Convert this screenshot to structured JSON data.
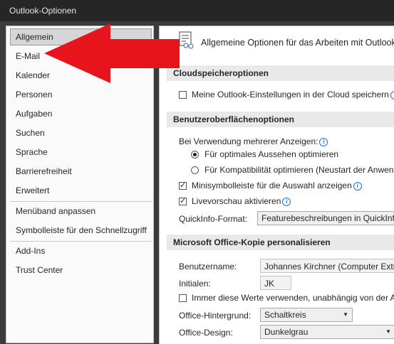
{
  "window": {
    "title": "Outlook-Optionen"
  },
  "sidebar": {
    "items": [
      {
        "label": "Allgemein",
        "active": true
      },
      {
        "label": "E-Mail"
      },
      {
        "label": "Kalender"
      },
      {
        "label": "Personen"
      },
      {
        "label": "Aufgaben"
      },
      {
        "label": "Suchen"
      },
      {
        "label": "Sprache"
      },
      {
        "label": "Barrierefreiheit"
      },
      {
        "label": "Erweitert"
      },
      {
        "label": "Menüband anpassen"
      },
      {
        "label": "Symbolleiste für den Schnellzugriff"
      },
      {
        "label": "Add-Ins"
      },
      {
        "label": "Trust Center"
      }
    ]
  },
  "main": {
    "header": "Allgemeine Optionen für das Arbeiten mit Outlook.",
    "cloud": {
      "title": "Cloudspeicheroptionen",
      "checkbox_label": "Meine Outlook-Einstellungen in der Cloud speichern",
      "checked": false
    },
    "ui": {
      "title": "Benutzeroberflächenoptionen",
      "multi_display_label": "Bei Verwendung mehrerer Anzeigen:",
      "radio_optimal": "Für optimales Aussehen optimieren",
      "radio_compat": "Für Kompatibilität optimieren (Neustart der Anwendung erforderlich)",
      "selected_radio": "optimal",
      "mini_toolbar": "Minisymbolleiste für die Auswahl anzeigen",
      "mini_toolbar_checked": true,
      "live_preview": "Livevorschau aktivieren",
      "live_preview_checked": true,
      "quickinfo_label": "QuickInfo-Format:",
      "quickinfo_value": "Featurebeschreibungen in QuickInfos anzeigen"
    },
    "office": {
      "title": "Microsoft Office-Kopie personalisieren",
      "username_label": "Benutzername:",
      "username_value": "Johannes Kirchner (Computer Extra)",
      "initials_label": "Initialen:",
      "initials_value": "JK",
      "always_use": "Immer diese Werte verwenden, unabhängig von der Anmeldung bei Office",
      "always_use_checked": false,
      "background_label": "Office-Hintergrund:",
      "background_value": "Schaltkreis",
      "design_label": "Office-Design:",
      "design_value": "Dunkelgrau"
    }
  },
  "annotation": {
    "arrow_color": "#e8141c"
  }
}
